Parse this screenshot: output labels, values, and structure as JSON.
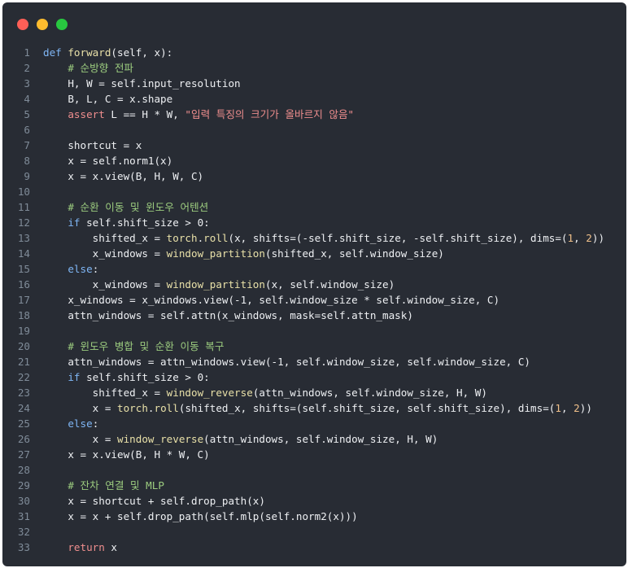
{
  "window": {
    "controls": [
      {
        "name": "close",
        "color": "#ff5f57"
      },
      {
        "name": "minimize",
        "color": "#febc2e"
      },
      {
        "name": "maximize",
        "color": "#28c840"
      }
    ]
  },
  "code": {
    "lines": [
      [
        {
          "t": "def ",
          "c": "kw"
        },
        {
          "t": "forward",
          "c": "fn"
        },
        {
          "t": "(self, x):",
          "c": "id"
        }
      ],
      [
        {
          "t": "    # 순방향 전파",
          "c": "cm"
        }
      ],
      [
        {
          "t": "    H, W = self.input_resolution",
          "c": "id"
        }
      ],
      [
        {
          "t": "    B, L, C = x.shape",
          "c": "id"
        }
      ],
      [
        {
          "t": "    ",
          "c": "id"
        },
        {
          "t": "assert",
          "c": "str"
        },
        {
          "t": " L == H * W, ",
          "c": "id"
        },
        {
          "t": "\"입력 특징의 크기가 올바르지 않음\"",
          "c": "str"
        }
      ],
      [],
      [
        {
          "t": "    shortcut = x",
          "c": "id"
        }
      ],
      [
        {
          "t": "    x = self.norm1(x)",
          "c": "id"
        }
      ],
      [
        {
          "t": "    x = x.view(B, H, W, C)",
          "c": "id"
        }
      ],
      [],
      [
        {
          "t": "    # 순환 이동 및 윈도우 어텐션",
          "c": "cm"
        }
      ],
      [
        {
          "t": "    ",
          "c": "id"
        },
        {
          "t": "if",
          "c": "kw"
        },
        {
          "t": " self.shift_size > 0:",
          "c": "id"
        }
      ],
      [
        {
          "t": "        shifted_x = ",
          "c": "id"
        },
        {
          "t": "torch",
          "c": "fn"
        },
        {
          "t": ".",
          "c": "id"
        },
        {
          "t": "roll",
          "c": "fn"
        },
        {
          "t": "(x, shifts=(-self.shift_size, -self.shift_size), dims=(",
          "c": "id"
        },
        {
          "t": "1",
          "c": "num"
        },
        {
          "t": ", ",
          "c": "id"
        },
        {
          "t": "2",
          "c": "num"
        },
        {
          "t": "))",
          "c": "id"
        }
      ],
      [
        {
          "t": "        x_windows = ",
          "c": "id"
        },
        {
          "t": "window_partition",
          "c": "fn"
        },
        {
          "t": "(shifted_x, self.window_size)",
          "c": "id"
        }
      ],
      [
        {
          "t": "    ",
          "c": "id"
        },
        {
          "t": "else",
          "c": "kw"
        },
        {
          "t": ":",
          "c": "id"
        }
      ],
      [
        {
          "t": "        x_windows = ",
          "c": "id"
        },
        {
          "t": "window_partition",
          "c": "fn"
        },
        {
          "t": "(x, self.window_size)",
          "c": "id"
        }
      ],
      [
        {
          "t": "    x_windows = x_windows.view(-1, self.window_size * self.window_size, C)",
          "c": "id"
        }
      ],
      [
        {
          "t": "    attn_windows = self.attn(x_windows, mask=self.attn_mask)",
          "c": "id"
        }
      ],
      [],
      [
        {
          "t": "    # 윈도우 병합 및 순환 이동 복구",
          "c": "cm"
        }
      ],
      [
        {
          "t": "    attn_windows = attn_windows.view(-1, self.window_size, self.window_size, C)",
          "c": "id"
        }
      ],
      [
        {
          "t": "    ",
          "c": "id"
        },
        {
          "t": "if",
          "c": "kw"
        },
        {
          "t": " self.shift_size > 0:",
          "c": "id"
        }
      ],
      [
        {
          "t": "        shifted_x = ",
          "c": "id"
        },
        {
          "t": "window_reverse",
          "c": "fn"
        },
        {
          "t": "(attn_windows, self.window_size, H, W)",
          "c": "id"
        }
      ],
      [
        {
          "t": "        x = ",
          "c": "id"
        },
        {
          "t": "torch",
          "c": "fn"
        },
        {
          "t": ".",
          "c": "id"
        },
        {
          "t": "roll",
          "c": "fn"
        },
        {
          "t": "(shifted_x, shifts=(self.shift_size, self.shift_size), dims=(",
          "c": "id"
        },
        {
          "t": "1",
          "c": "num"
        },
        {
          "t": ", ",
          "c": "id"
        },
        {
          "t": "2",
          "c": "num"
        },
        {
          "t": "))",
          "c": "id"
        }
      ],
      [
        {
          "t": "    ",
          "c": "id"
        },
        {
          "t": "else",
          "c": "kw"
        },
        {
          "t": ":",
          "c": "id"
        }
      ],
      [
        {
          "t": "        x = ",
          "c": "id"
        },
        {
          "t": "window_reverse",
          "c": "fn"
        },
        {
          "t": "(attn_windows, self.window_size, H, W)",
          "c": "id"
        }
      ],
      [
        {
          "t": "    x = x.view(B, H * W, C)",
          "c": "id"
        }
      ],
      [],
      [
        {
          "t": "    # 잔차 연결 및 MLP",
          "c": "cm"
        }
      ],
      [
        {
          "t": "    x = shortcut + self.drop_path(x)",
          "c": "id"
        }
      ],
      [
        {
          "t": "    x = x + self.drop_path(self.mlp(self.norm2(x)))",
          "c": "id"
        }
      ],
      [],
      [
        {
          "t": "    ",
          "c": "id"
        },
        {
          "t": "return",
          "c": "str"
        },
        {
          "t": " x",
          "c": "id"
        }
      ]
    ]
  }
}
